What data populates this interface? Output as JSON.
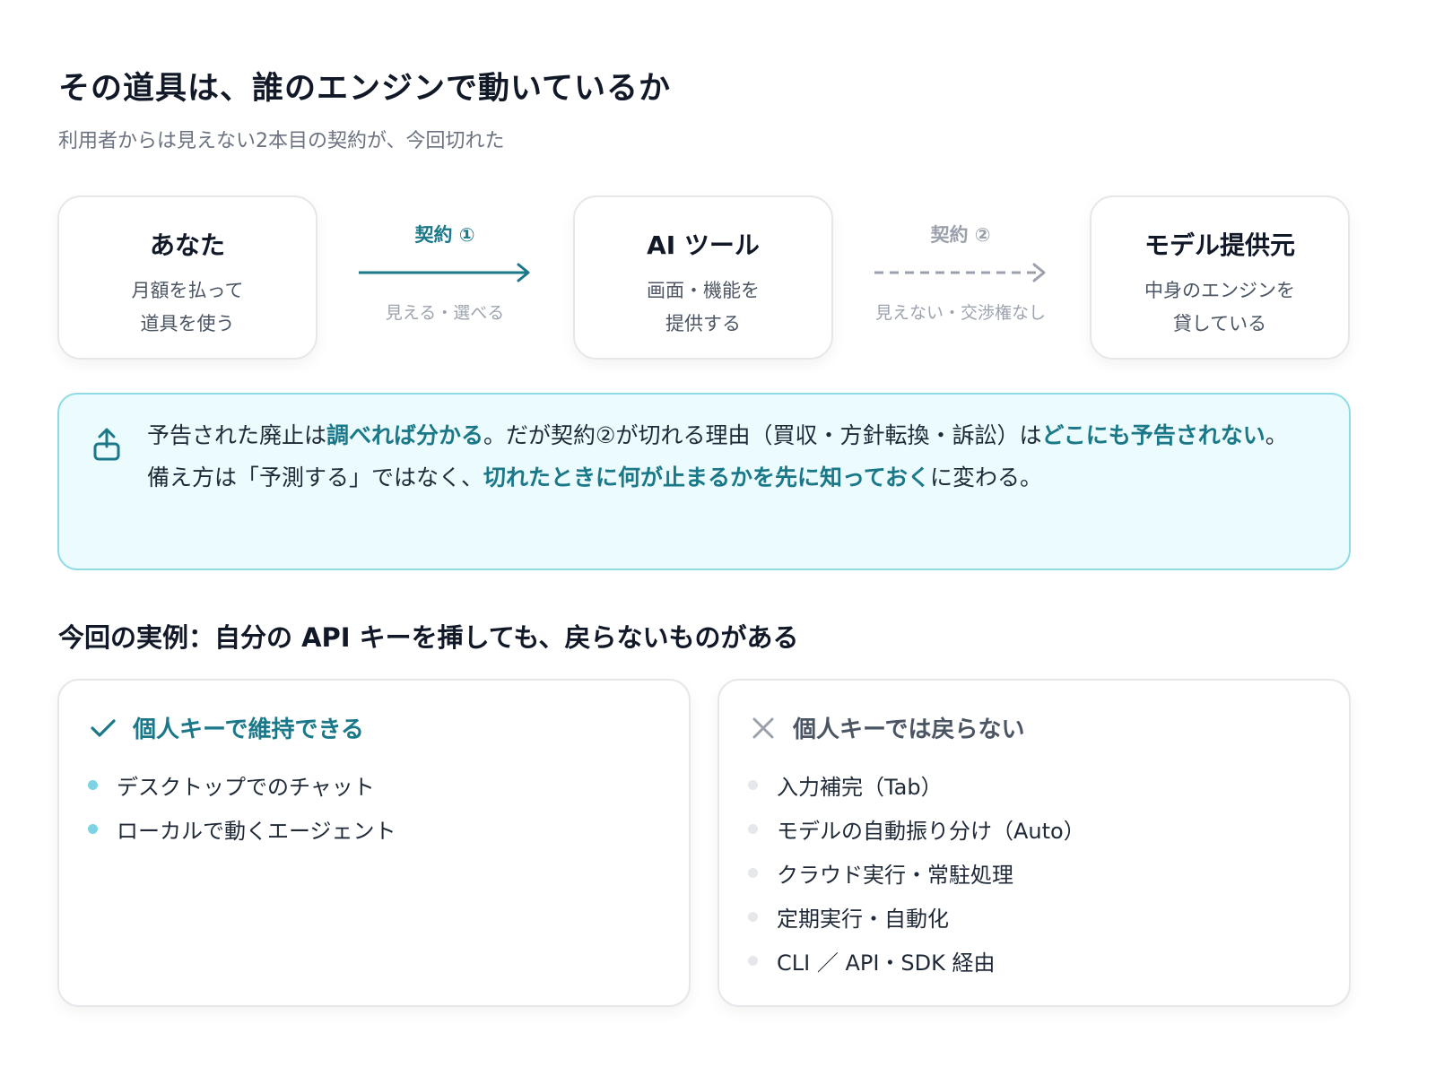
{
  "header": {
    "title": "その道具は、誰のエンジンで動いているか",
    "subtitle": "利用者からは見えない2本目の契約が、今回切れた"
  },
  "flow": {
    "nodes": [
      {
        "title": "あなた",
        "desc_lines": [
          "月額を払って",
          "道具を使う"
        ]
      },
      {
        "title": "AI ツール",
        "desc_lines": [
          "画面・機能を",
          "提供する"
        ]
      },
      {
        "title": "モデル提供元",
        "desc_lines": [
          "中身のエンジンを",
          "貸している"
        ]
      }
    ],
    "edges": [
      {
        "label": "契約 ①",
        "note": "見える・選べる",
        "style": "solid",
        "color": "#1a7889"
      },
      {
        "label": "契約 ②",
        "note": "見えない・交渉権なし",
        "style": "dashed",
        "color": "#9aa1ac"
      }
    ]
  },
  "callout": {
    "icon": "share-upload-icon",
    "p1": [
      "予告された廃止は",
      "調べれば分かる",
      "。だが契約②が切れる理由（買収・方針転換・訴訟）は",
      "どこにも予告されない",
      "。"
    ],
    "p2": [
      "備え方は「予測する」ではなく、",
      "切れたときに何が止まるかを先に知っておく",
      "に変わる。"
    ]
  },
  "section": {
    "title": "今回の実例：自分の API キーを挿しても、戻らないものがある"
  },
  "cards": {
    "keep": {
      "icon": "check-icon",
      "title": "個人キーで維持できる",
      "items": [
        "デスクトップでのチャット",
        "ローカルで動くエージェント"
      ]
    },
    "lost": {
      "icon": "cross-icon",
      "title": "個人キーでは戻らない",
      "items": [
        "入力補完（Tab）",
        "モデルの自動振り分け（Auto）",
        "クラウド実行・常駐処理",
        "定期実行・自動化",
        "CLI ／ API・SDK 経由"
      ]
    }
  },
  "colors": {
    "accent": "#1a7889",
    "callout_bg": "#ecfcfe",
    "callout_border": "#8edbe6",
    "muted": "#9aa1ac"
  }
}
